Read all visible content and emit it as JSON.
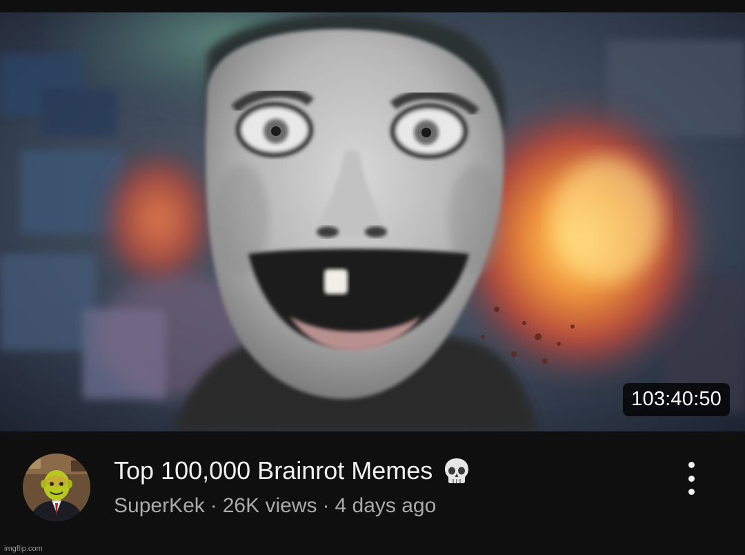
{
  "video": {
    "duration": "103:40:50",
    "title": "Top 100,000 Brainrot Memes",
    "title_emoji_icon": "skull-icon",
    "channel": "SuperKek",
    "separator": "·",
    "views": "26K views",
    "published": "4 days ago"
  },
  "menu": {
    "icon": "more-vertical-icon"
  },
  "watermark": {
    "text": "imgflip.com"
  },
  "colors": {
    "background": "#0f0f0f",
    "title_text": "#f1f1f1",
    "meta_text": "#aaaaaa",
    "duration_bg": "#000000"
  }
}
